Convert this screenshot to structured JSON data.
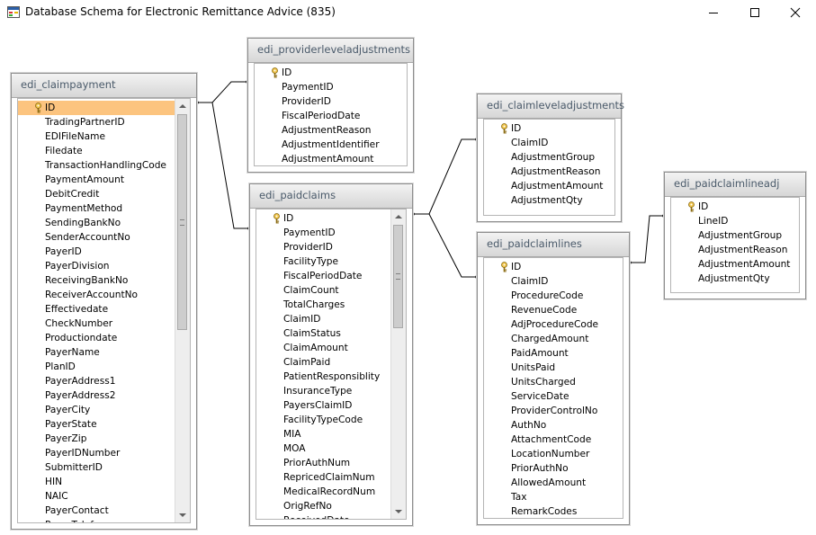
{
  "window": {
    "title": "Database Schema for Electronic Remittance Advice (835)"
  },
  "icons": {
    "app": "database-window-icon",
    "minimize": "minimize-icon",
    "maximize": "maximize-icon",
    "close": "close-icon",
    "key": "primary-key-icon"
  },
  "colors": {
    "selection": "#fcc47f",
    "header_text": "#4a5a6a",
    "border": "#8e8e8e"
  },
  "tables": [
    {
      "id": "edi_claimpayment",
      "title": "edi_claimpayment",
      "has_scrollbar": true,
      "scroll_position": 0,
      "scroll_visible_fraction": 0.55,
      "primary_key_index": 0,
      "selected_index": 0,
      "fields": [
        "ID",
        "TradingPartnerID",
        "EDIFileName",
        "Filedate",
        "TransactionHandlingCode",
        "PaymentAmount",
        "DebitCredit",
        "PaymentMethod",
        "SendingBankNo",
        "SenderAccountNo",
        "PayerID",
        "PayerDivision",
        "ReceivingBankNo",
        "ReceiverAccountNo",
        "Effectivedate",
        "CheckNumber",
        "Productiondate",
        "PayerName",
        "PlanID",
        "PayerAddress1",
        "PayerAddress2",
        "PayerCity",
        "PayerState",
        "PayerZip",
        "PayerIDNumber",
        "SubmitterID",
        "HIN",
        "NAIC",
        "PayerContact",
        "PayerTelefon"
      ]
    },
    {
      "id": "edi_providerleveladjustments",
      "title": "edi_providerleveladjustments",
      "has_scrollbar": false,
      "primary_key_index": 0,
      "selected_index": -1,
      "fields": [
        "ID",
        "PaymentID",
        "ProviderID",
        "FiscalPeriodDate",
        "AdjustmentReason",
        "AdjustmentIdentifier",
        "AdjustmentAmount"
      ]
    },
    {
      "id": "edi_paidclaims",
      "title": "edi_paidclaims",
      "has_scrollbar": true,
      "scroll_position": 0,
      "scroll_visible_fraction": 0.37,
      "primary_key_index": 0,
      "selected_index": -1,
      "fields": [
        "ID",
        "PaymentID",
        "ProviderID",
        "FacilityType",
        "FiscalPeriodDate",
        "ClaimCount",
        "TotalCharges",
        "ClaimID",
        "ClaimStatus",
        "ClaimAmount",
        "ClaimPaid",
        "PatientResponsiblity",
        "InsuranceType",
        "PayersClaimID",
        "FacilityTypeCode",
        "MIA",
        "MOA",
        "PriorAuthNum",
        "RepricedClaimNum",
        "MedicalRecordNum",
        "OrigRefNo",
        "ReceivedDate"
      ]
    },
    {
      "id": "edi_claimleveladjustments",
      "title": "edi_claimleveladjustments",
      "has_scrollbar": false,
      "primary_key_index": 0,
      "selected_index": -1,
      "fields": [
        "ID",
        "ClaimID",
        "AdjustmentGroup",
        "AdjustmentReason",
        "AdjustmentAmount",
        "AdjustmentQty"
      ]
    },
    {
      "id": "edi_paidclaimlines",
      "title": "edi_paidclaimlines",
      "has_scrollbar": false,
      "primary_key_index": 0,
      "selected_index": -1,
      "fields": [
        "ID",
        "ClaimID",
        "ProcedureCode",
        "RevenueCode",
        "AdjProcedureCode",
        "ChargedAmount",
        "PaidAmount",
        "UnitsPaid",
        "UnitsCharged",
        "ServiceDate",
        "ProviderControlNo",
        "AuthNo",
        "AttachmentCode",
        "LocationNumber",
        "PriorAuthNo",
        "AllowedAmount",
        "Tax",
        "RemarkCodes"
      ]
    },
    {
      "id": "edi_paidclaimlineadj",
      "title": "edi_paidclaimlineadj",
      "has_scrollbar": false,
      "primary_key_index": 0,
      "selected_index": -1,
      "fields": [
        "ID",
        "LineID",
        "AdjustmentGroup",
        "AdjustmentReason",
        "AdjustmentAmount",
        "AdjustmentQty"
      ]
    }
  ],
  "relationships": [
    {
      "from": "edi_claimpayment",
      "to": "edi_providerleveladjustments"
    },
    {
      "from": "edi_claimpayment",
      "to": "edi_paidclaims"
    },
    {
      "from": "edi_paidclaims",
      "to": "edi_claimleveladjustments"
    },
    {
      "from": "edi_paidclaims",
      "to": "edi_paidclaimlines"
    },
    {
      "from": "edi_paidclaimlines",
      "to": "edi_paidclaimlineadj"
    }
  ]
}
